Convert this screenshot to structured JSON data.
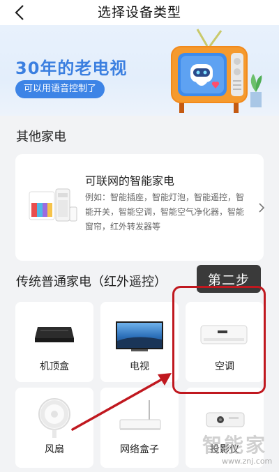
{
  "header": {
    "title": "选择设备类型",
    "back_icon": "chevron-left-icon"
  },
  "banner": {
    "title": "30年的老电视",
    "pill": "可以用语音控制了",
    "accent": "#3b7fe0"
  },
  "sections": {
    "other": "其他家电",
    "traditional": "传统普通家电（红外遥控）"
  },
  "smart_card": {
    "title": "可联网的智能家电",
    "description": "例如：智能插座，智能灯泡，智能遥控，智能开关，智能空调，智能空气净化器，智能窗帘，红外转发器等"
  },
  "step_badge": "第二步",
  "devices": [
    {
      "label": "机顶盒",
      "icon": "set-top-box-icon"
    },
    {
      "label": "电视",
      "icon": "tv-icon"
    },
    {
      "label": "空调",
      "icon": "air-conditioner-icon"
    },
    {
      "label": "风扇",
      "icon": "fan-icon"
    },
    {
      "label": "网络盒子",
      "icon": "network-box-icon"
    },
    {
      "label": "投影仪",
      "icon": "projector-icon"
    }
  ],
  "watermark": {
    "text": "智能家",
    "url": "www.znj.com"
  },
  "colors": {
    "highlight": "#c0181f",
    "pill": "#3d84e6",
    "badge": "#3a3a3a"
  }
}
